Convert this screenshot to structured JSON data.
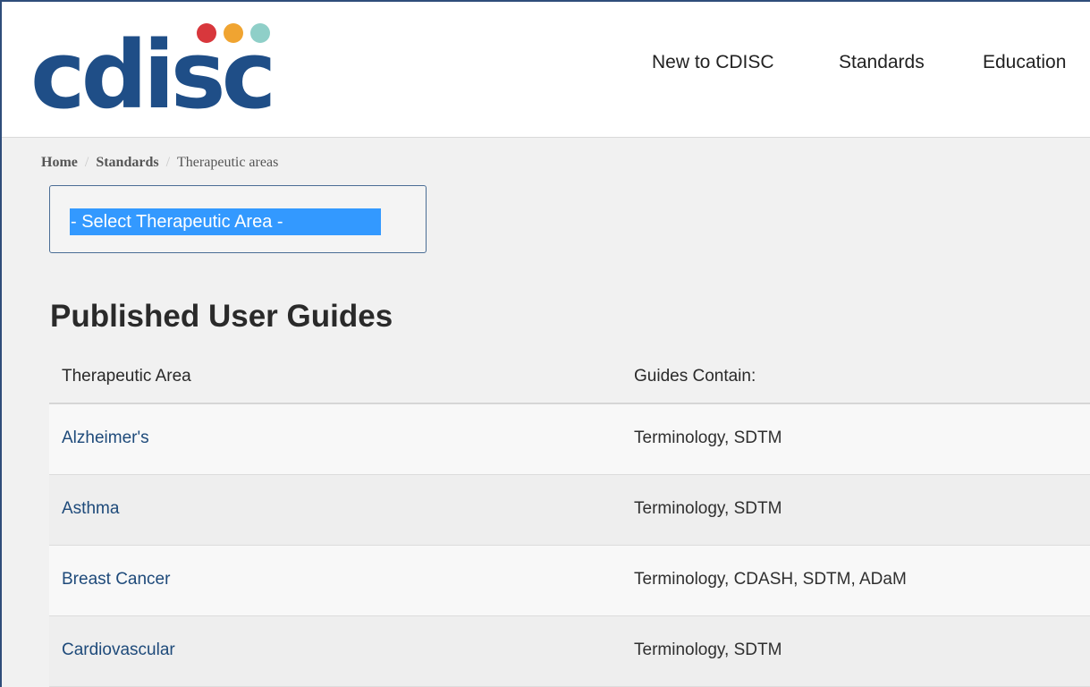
{
  "brand": {
    "logo_text": "cdisc",
    "dot_colors": [
      "#d8373c",
      "#f0a431",
      "#8fcfc8"
    ],
    "primary_color": "#1f4e87"
  },
  "nav": {
    "items": [
      "New to CDISC",
      "Standards",
      "Education"
    ]
  },
  "breadcrumb": {
    "home": "Home",
    "standards": "Standards",
    "current": "Therapeutic areas",
    "separator": "/"
  },
  "select": {
    "selected_value": "- Select Therapeutic Area -",
    "highlight_color": "#3399ff"
  },
  "main": {
    "title": "Published User Guides",
    "table": {
      "headers": [
        "Therapeutic Area",
        "Guides Contain:"
      ],
      "rows": [
        {
          "area": "Alzheimer's",
          "guides": "Terminology, SDTM"
        },
        {
          "area": "Asthma",
          "guides": "Terminology, SDTM"
        },
        {
          "area": "Breast Cancer",
          "guides": "Terminology, CDASH, SDTM, ADaM"
        },
        {
          "area": "Cardiovascular",
          "guides": "Terminology, SDTM"
        }
      ]
    }
  }
}
